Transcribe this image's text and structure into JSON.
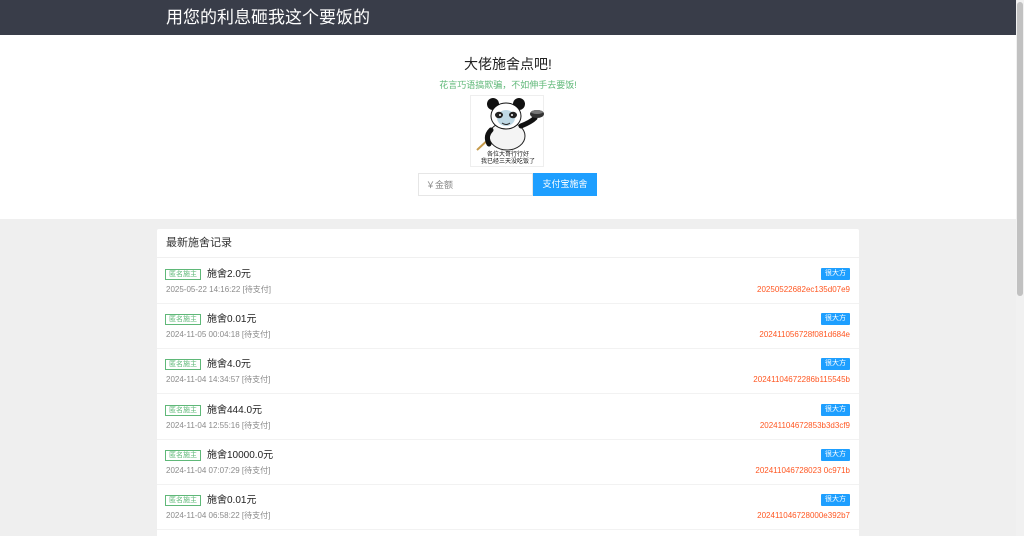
{
  "header": {
    "title": "用您的利息砸我这个要饭的"
  },
  "hero": {
    "title": "大佬施舍点吧!",
    "subtitle": "花言巧语搞欺骗，不如伸手去要饭!",
    "image_caption_line1": "各位大哥行行好",
    "image_caption_line2": "我已经三天没吃饭了",
    "amount_placeholder": "￥金额",
    "pay_button_label": "支付宝施舍"
  },
  "records": {
    "heading": "最新施舍记录",
    "items": [
      {
        "badge": "匿名施主",
        "amount": "施舍2.0元",
        "meta": "2025-05-22 14:16:22 [待支付]",
        "tag": "很大方",
        "order": "20250522682ec135d07e9"
      },
      {
        "badge": "匿名施主",
        "amount": "施舍0.01元",
        "meta": "2024-11-05 00:04:18 [待支付]",
        "tag": "很大方",
        "order": "202411056728f081d684e"
      },
      {
        "badge": "匿名施主",
        "amount": "施舍4.0元",
        "meta": "2024-11-04 14:34:57 [待支付]",
        "tag": "很大方",
        "order": "20241104672286b115545b"
      },
      {
        "badge": "匿名施主",
        "amount": "施舍444.0元",
        "meta": "2024-11-04 12:55:16 [待支付]",
        "tag": "很大方",
        "order": "20241104672853b3d3cf9"
      },
      {
        "badge": "匿名施主",
        "amount": "施舍10000.0元",
        "meta": "2024-11-04 07:07:29 [待支付]",
        "tag": "很大方",
        "order": "202411046728023 0c971b"
      },
      {
        "badge": "匿名施主",
        "amount": "施舍0.01元",
        "meta": "2024-11-04 06:58:22 [待支付]",
        "tag": "很大方",
        "order": "202411046728000e392b7"
      }
    ]
  }
}
